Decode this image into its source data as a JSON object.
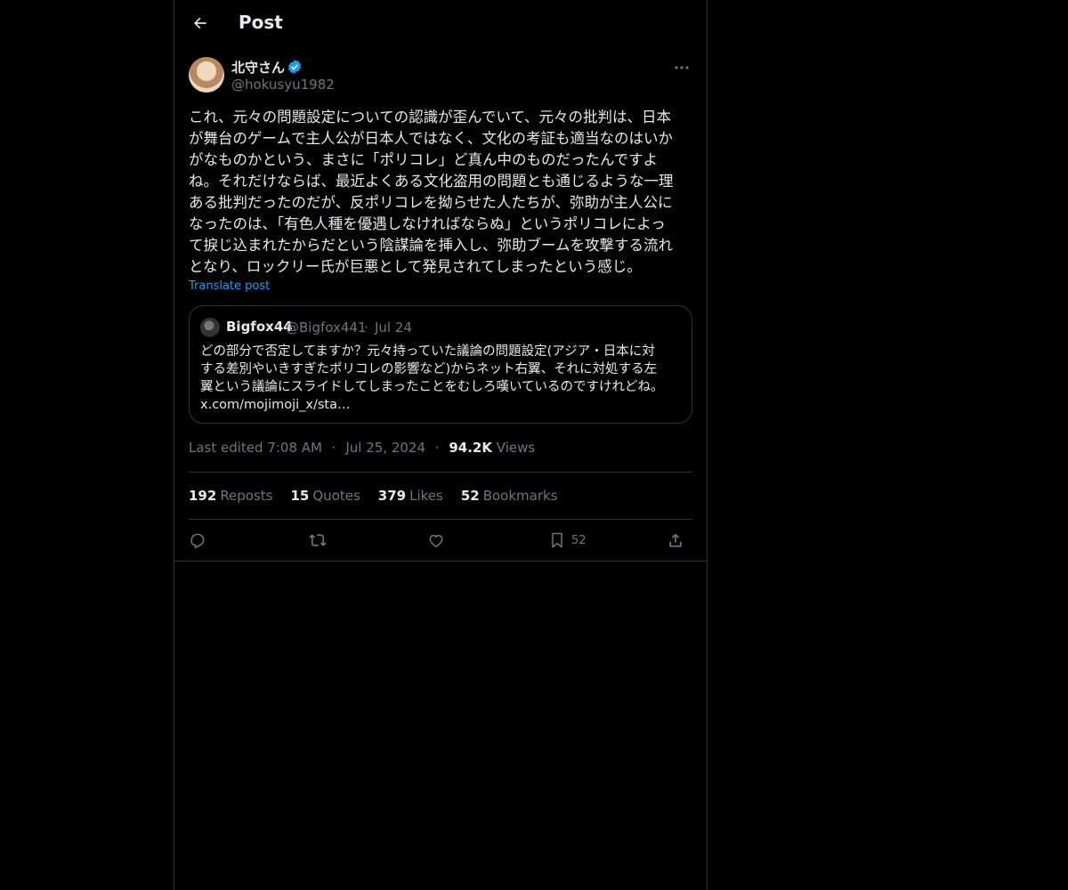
{
  "header": {
    "title": "Post"
  },
  "author": {
    "name": "北守さん",
    "handle": "@hokusyu1982"
  },
  "post": {
    "text": "これ、元々の問題設定についての認識が歪んでいて、元々の批判は、日本\nが舞台のゲームで主人公が日本人ではなく、文化の考証も適当なのはいか\nがなものかという、まさに「ポリコレ」ど真ん中のものだったんですよ\nね。それだけならば、最近よくある文化盗用の問題とも通じるような一理\nある批判だったのだが、反ポリコレを拗らせた人たちが、弥助が主人公に\nなったのは、「有色人種を優遇しなければならぬ」というポリコレによっ\nて捩じ込まれたからだという陰謀論を挿入し、弥助ブームを攻撃する流れ\nとなり、ロックリー氏が巨悪として発見されてしまったという感じ。",
    "translate_label": "Translate post"
  },
  "quote": {
    "name": "Bigfox44",
    "handle": "@Bigfox441",
    "separator": "·",
    "date": "Jul 24",
    "text": "どの部分で否定してますか？元々持っていた議論の問題設定(アジア・日本に対\nする差別やいきすぎたポリコレの影響など)からネット右翼、それに対処する左\n翼という議論にスライドしてしまったことをむしろ嘆いているのですけれどね。\nx.com/mojimoji_x/sta…"
  },
  "meta": {
    "edited": "Last edited 7:08 AM",
    "sep1": "·",
    "date": "Jul 25, 2024",
    "sep2": "·",
    "views_count": "94.2K",
    "views_label": "Views"
  },
  "stats": [
    {
      "count": "192",
      "label": "Reposts"
    },
    {
      "count": "15",
      "label": "Quotes"
    },
    {
      "count": "379",
      "label": "Likes"
    },
    {
      "count": "52",
      "label": "Bookmarks"
    }
  ],
  "actions": {
    "bookmark_count": "52"
  },
  "colors": {
    "accent": "#1d9bf0",
    "muted": "#71767b",
    "border": "#2f3336",
    "text": "#e7e9ea"
  }
}
